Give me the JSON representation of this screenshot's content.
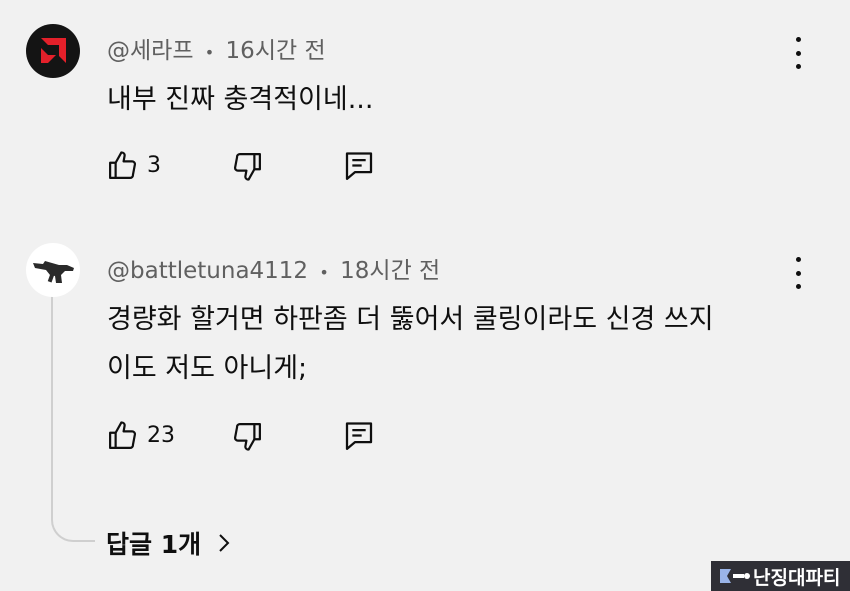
{
  "comments": [
    {
      "author": "@세라프",
      "separator": "•",
      "time": "16시간 전",
      "text": "내부 진짜 충격적이네...",
      "likes": "3",
      "avatar": "amd-logo-icon",
      "accent": "#e4202a"
    },
    {
      "author": "@battletuna4112",
      "separator": "•",
      "time": "18시간 전",
      "text_lines": [
        "경량화 할거면 하판좀 더 뚫어서 쿨링이라도 신경 쓰지",
        "이도 저도 아니게;"
      ],
      "likes": "23",
      "avatar": "rifle-icon",
      "replies_label": "답글 1개"
    }
  ],
  "watermark": {
    "label": "난징대파티"
  }
}
